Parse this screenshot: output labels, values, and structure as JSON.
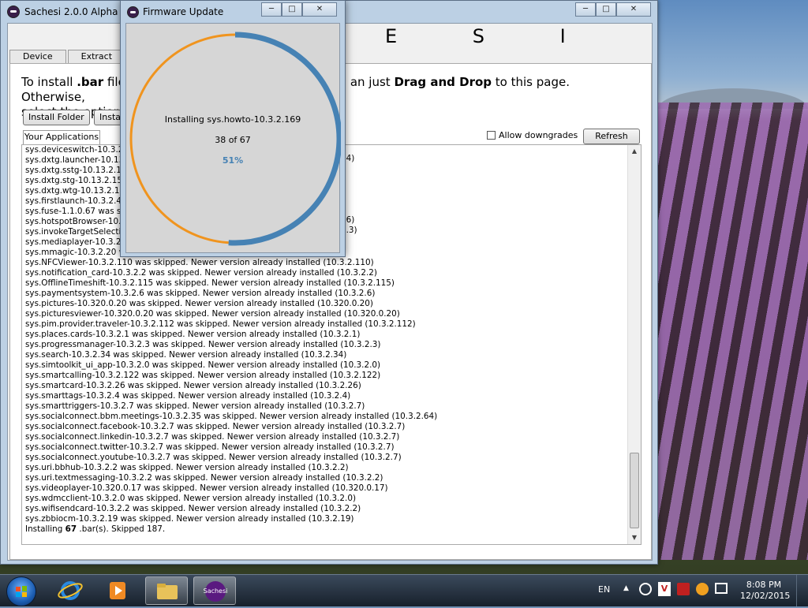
{
  "main_window": {
    "title": "Sachesi 2.0.0 Alpha",
    "banner": "E S I",
    "tabs": [
      "Device",
      "Extract"
    ],
    "instructions_html_parts": {
      "p1": "To install ",
      "p2": ".bar",
      "p3": " file",
      "p4": "an just ",
      "p5": "Drag and Drop",
      "p6": " to this page. Otherwise,",
      "p7": "select the options"
    },
    "install_folder_label": "Install Folder",
    "install_label": "Instal",
    "your_apps_label": "Your Applications",
    "allow_downgrades_label": "Allow downgrades",
    "refresh_label": "Refresh",
    "log_lines": [
      "sys.deviceswitch-10.3.2.",
      "sys.dxtg.launcher-10.13.",
      "sys.dxtg.sstg-10.13.2.14",
      "sys.dxtg.stg-10.13.2.15",
      "sys.dxtg.wtg-10.13.2.14",
      "sys.firstlaunch-10.3.2.44",
      "sys.fuse-1.1.0.67 was sk",
      "sys.hotspotBrowser-10.3.",
      "sys.invokeTargetSelection",
      "sys.mediaplayer-10.3.2.1",
      "sys.mmagic-10.3.2.20 wa",
      "sys.NFCViewer-10.3.2.110 was skipped. Newer version already installed (10.3.2.110)",
      "sys.notification_card-10.3.2.2 was skipped. Newer version already installed (10.3.2.2)",
      "sys.OfflineTimeshift-10.3.2.115 was skipped. Newer version already installed (10.3.2.115)",
      "sys.paymentsystem-10.3.2.6 was skipped. Newer version already installed (10.3.2.6)",
      "sys.pictures-10.320.0.20 was skipped. Newer version already installed (10.320.0.20)",
      "sys.picturesviewer-10.320.0.20 was skipped. Newer version already installed (10.320.0.20)",
      "sys.pim.provider.traveler-10.3.2.112 was skipped. Newer version already installed (10.3.2.112)",
      "sys.places.cards-10.3.2.1 was skipped. Newer version already installed (10.3.2.1)",
      "sys.progressmanager-10.3.2.3 was skipped. Newer version already installed (10.3.2.3)",
      "sys.search-10.3.2.34 was skipped. Newer version already installed (10.3.2.34)",
      "sys.simtoolkit_ui_app-10.3.2.0 was skipped. Newer version already installed (10.3.2.0)",
      "sys.smartcalling-10.3.2.122 was skipped. Newer version already installed (10.3.2.122)",
      "sys.smartcard-10.3.2.26 was skipped. Newer version already installed (10.3.2.26)",
      "sys.smarttags-10.3.2.4 was skipped. Newer version already installed (10.3.2.4)",
      "sys.smarttriggers-10.3.2.7 was skipped. Newer version already installed (10.3.2.7)",
      "sys.socialconnect.bbm.meetings-10.3.2.35 was skipped. Newer version already installed (10.3.2.64)",
      "sys.socialconnect.facebook-10.3.2.7 was skipped. Newer version already installed (10.3.2.7)",
      "sys.socialconnect.linkedin-10.3.2.7 was skipped. Newer version already installed (10.3.2.7)",
      "sys.socialconnect.twitter-10.3.2.7 was skipped. Newer version already installed (10.3.2.7)",
      "sys.socialconnect.youtube-10.3.2.7 was skipped. Newer version already installed (10.3.2.7)",
      "sys.uri.bbhub-10.3.2.2 was skipped. Newer version already installed (10.3.2.2)",
      "sys.uri.textmessaging-10.3.2.2 was skipped. Newer version already installed (10.3.2.2)",
      "sys.videoplayer-10.320.0.17 was skipped. Newer version already installed (10.320.0.17)",
      "sys.wdmcclient-10.3.2.0 was skipped. Newer version already installed (10.3.2.0)",
      "sys.wifisendcard-10.3.2.2 was skipped. Newer version already installed (10.3.2.2)",
      "sys.zbbiocm-10.3.2.19 was skipped. Newer version already installed (10.3.2.19)"
    ],
    "log_partial_right": [
      "14)",
      "36)",
      "2.3)"
    ],
    "summary": {
      "pre": "Installing ",
      "count": "67",
      "post": " .bar(s). Skipped 187."
    }
  },
  "dialog": {
    "title": "Firmware Update",
    "installing_text": "Installing sys.howto-10.3.2.169",
    "progress_count_text": "38 of 67",
    "percent_text": "51%",
    "progress_fraction": 0.51,
    "ring_color": "#4682b4",
    "ring_track_color": "#f0941e"
  },
  "taskbar": {
    "language": "EN",
    "time": "8:08 PM",
    "date": "12/02/2015",
    "sachesi_label": "Sachesi",
    "icons": [
      "start-orb-icon",
      "internet-explorer-icon",
      "media-player-icon",
      "file-explorer-icon",
      "sachesi-app-icon"
    ]
  }
}
